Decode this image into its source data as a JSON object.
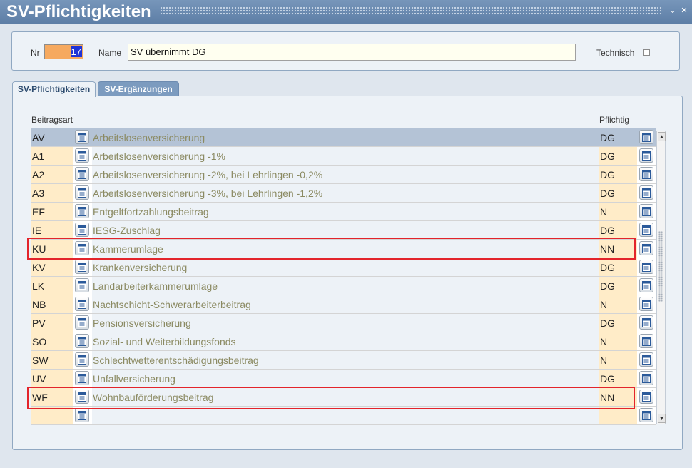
{
  "window": {
    "title": "SV-Pflichtigkeiten",
    "minimize_glyph": "⌄",
    "close_glyph": "✕"
  },
  "header": {
    "nr_label": "Nr",
    "nr_value": "17",
    "name_label": "Name",
    "name_value": "SV übernimmt DG",
    "technisch_label": "Technisch",
    "technisch_checked": false
  },
  "tabs": [
    {
      "label": "SV-Pflichtigkeiten",
      "active": true
    },
    {
      "label": "SV-Ergänzungen",
      "active": false
    }
  ],
  "grid": {
    "col_beitragsart": "Beitragsart",
    "col_pflichtig": "Pflichtig",
    "rows": [
      {
        "code": "AV",
        "desc": "Arbeitslosenversicherung",
        "pflichtig": "DG"
      },
      {
        "code": "A1",
        "desc": "Arbeitslosenversicherung -1%",
        "pflichtig": "DG"
      },
      {
        "code": "A2",
        "desc": "Arbeitslosenversicherung -2%, bei Lehrlingen -0,2%",
        "pflichtig": "DG"
      },
      {
        "code": "A3",
        "desc": "Arbeitslosenversicherung -3%, bei Lehrlingen -1,2%",
        "pflichtig": "DG"
      },
      {
        "code": "EF",
        "desc": "Entgeltfortzahlungsbeitrag",
        "pflichtig": "N"
      },
      {
        "code": "IE",
        "desc": "IESG-Zuschlag",
        "pflichtig": "DG"
      },
      {
        "code": "KU",
        "desc": "Kammerumlage",
        "pflichtig": "NN"
      },
      {
        "code": "KV",
        "desc": "Krankenversicherung",
        "pflichtig": "DG"
      },
      {
        "code": "LK",
        "desc": "Landarbeiterkammerumlage",
        "pflichtig": "DG"
      },
      {
        "code": "NB",
        "desc": "Nachtschicht-Schwerarbeiterbeitrag",
        "pflichtig": "N"
      },
      {
        "code": "PV",
        "desc": "Pensionsversicherung",
        "pflichtig": "DG"
      },
      {
        "code": "SO",
        "desc": "Sozial- und Weiterbildungsfonds",
        "pflichtig": "N"
      },
      {
        "code": "SW",
        "desc": "Schlechtwetterentschädigungsbeitrag",
        "pflichtig": "N"
      },
      {
        "code": "UV",
        "desc": "Unfallversicherung",
        "pflichtig": "DG"
      },
      {
        "code": "WF",
        "desc": "Wohnbauförderungsbeitrag",
        "pflichtig": "NN"
      },
      {
        "code": "",
        "desc": "",
        "pflichtig": ""
      }
    ]
  },
  "scrollbar": {
    "up_glyph": "▲",
    "down_glyph": "▼"
  },
  "colors": {
    "highlight": "#e3242b",
    "selected_row": "#b4c3d6",
    "code_cell": "#ffecc8",
    "nr_field": "#f6a95f",
    "desc_text": "#8b8a62"
  }
}
